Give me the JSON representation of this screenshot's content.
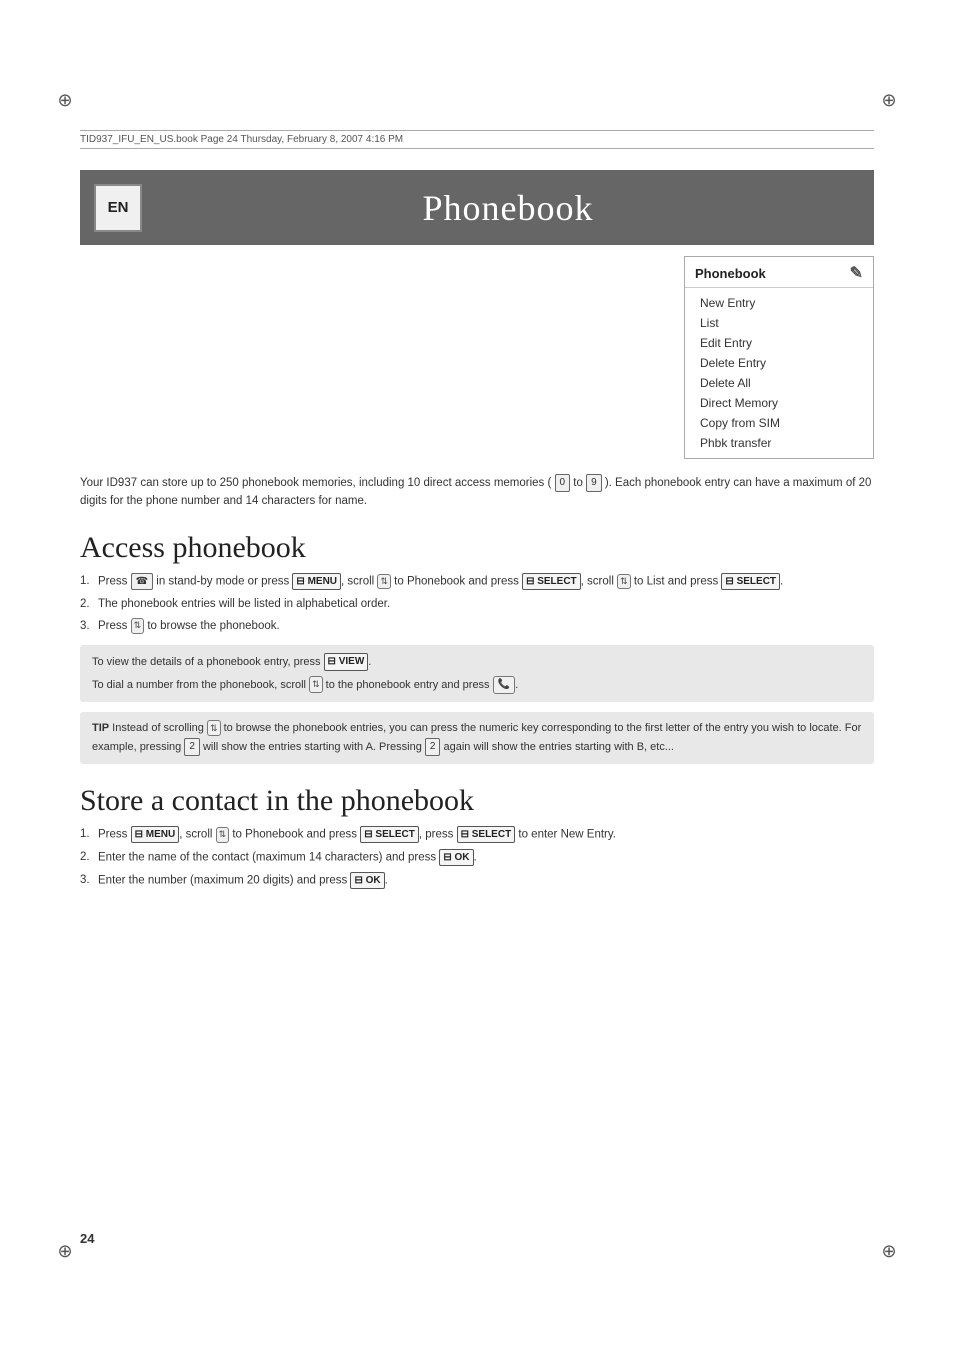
{
  "meta": {
    "file_info": "TID937_IFU_EN_US.book   Page 24   Thursday, February 8, 2007   4:16 PM"
  },
  "header": {
    "lang_code": "EN",
    "title": "Phonebook"
  },
  "phonebook_menu": {
    "title": "Phonebook",
    "items": [
      "New Entry",
      "List",
      "Edit Entry",
      "Delete Entry",
      "Delete All",
      "Direct Memory",
      "Copy from SIM",
      "Phbk transfer"
    ]
  },
  "intro": {
    "text": "Your ID937 can store up to 250 phonebook memories, including 10 direct access memories ( [0] to [9] ). Each phonebook entry can have a maximum of 20 digits for the phone number and 14 characters for name."
  },
  "section1": {
    "heading": "Access phonebook",
    "steps": [
      {
        "num": "1.",
        "text": "Press [antenna] in stand-by mode or press [MENU], scroll [scroll] to Phonebook and press [SELECT], scroll [scroll] to List and press [SELECT]."
      },
      {
        "num": "2.",
        "text": "The phonebook entries will be listed in alphabetical order."
      },
      {
        "num": "3.",
        "text": "Press [scroll] to browse the phonebook."
      }
    ],
    "tip_box": {
      "line1": "To view the details of a phonebook entry, press [VIEW].",
      "line2": "To dial a number from the phonebook, scroll [scroll] to the phonebook entry and press [call]."
    },
    "tip_note": {
      "text": "TIP  Instead of scrolling [scroll] to browse the phonebook entries, you can press the numeric key corresponding to the first letter of the entry you wish to locate. For example, pressing [2] will show the entries starting with A. Pressing [2] again will show the entries starting with B, etc..."
    }
  },
  "section2": {
    "heading": "Store a contact in the phonebook",
    "steps": [
      {
        "num": "1.",
        "text": "Press [MENU], scroll [scroll] to Phonebook and press [SELECT], press [SELECT] to enter New Entry."
      },
      {
        "num": "2.",
        "text": "Enter the name of the contact (maximum 14 characters) and press [OK]."
      },
      {
        "num": "3.",
        "text": "Enter the number (maximum 20 digits) and press [OK]."
      }
    ]
  },
  "page_number": "24"
}
